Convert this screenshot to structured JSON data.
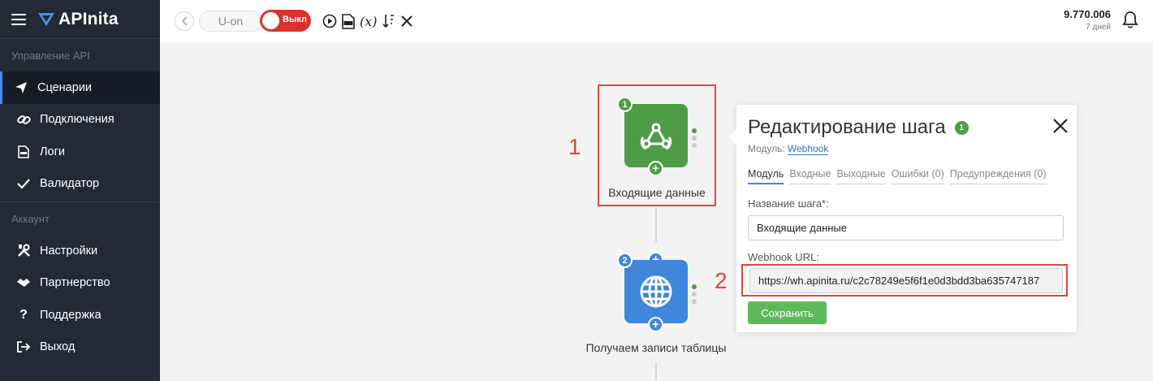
{
  "app": {
    "logo_text": "APInita"
  },
  "sidebar": {
    "section_api": "Управление API",
    "section_account": "Аккаунт",
    "items_api": [
      {
        "label": "Сценарии",
        "icon": "paper-plane-icon",
        "active": true
      },
      {
        "label": "Подключения",
        "icon": "link-icon"
      },
      {
        "label": "Логи",
        "icon": "log-file-icon"
      },
      {
        "label": "Валидатор",
        "icon": "check-icon"
      }
    ],
    "items_account": [
      {
        "label": "Настройки",
        "icon": "tools-icon"
      },
      {
        "label": "Партнерство",
        "icon": "handshake-icon"
      },
      {
        "label": "Поддержка",
        "icon": "question-icon"
      },
      {
        "label": "Выход",
        "icon": "logout-icon"
      }
    ]
  },
  "topbar": {
    "scenario_name": "U-on",
    "toggle_label": "Выкл",
    "toggle_state": "off",
    "variables_symbol": "(x)",
    "balance_amount": "9.770.006",
    "balance_days": "7 дней"
  },
  "canvas": {
    "nodes": [
      {
        "number": "1",
        "label": "Входящие данные",
        "color": "#4e9c45",
        "icon": "webhook-icon"
      },
      {
        "number": "2",
        "label": "Получаем записи таблицы",
        "color": "#3f86dc",
        "icon": "globe-icon"
      }
    ],
    "annotations": [
      "1",
      "2"
    ],
    "annotation_color": "#e0463a"
  },
  "panel": {
    "title": "Редактирование шага",
    "step_number": "1",
    "module_prefix": "Модуль:",
    "module_link": "Webhook",
    "tabs": [
      "Модуль",
      "Входные",
      "Выходные",
      "Ошибки (0)",
      "Предупреждения (0)"
    ],
    "active_tab": 0,
    "step_name_label": "Название шага*:",
    "step_name_value": "Входящие данные",
    "webhook_url_label": "Webhook URL:",
    "webhook_url_value": "https://wh.apinita.ru/c2c78249e5f6f1e0d3bdd3ba635747187",
    "save_label": "Сохранить"
  }
}
